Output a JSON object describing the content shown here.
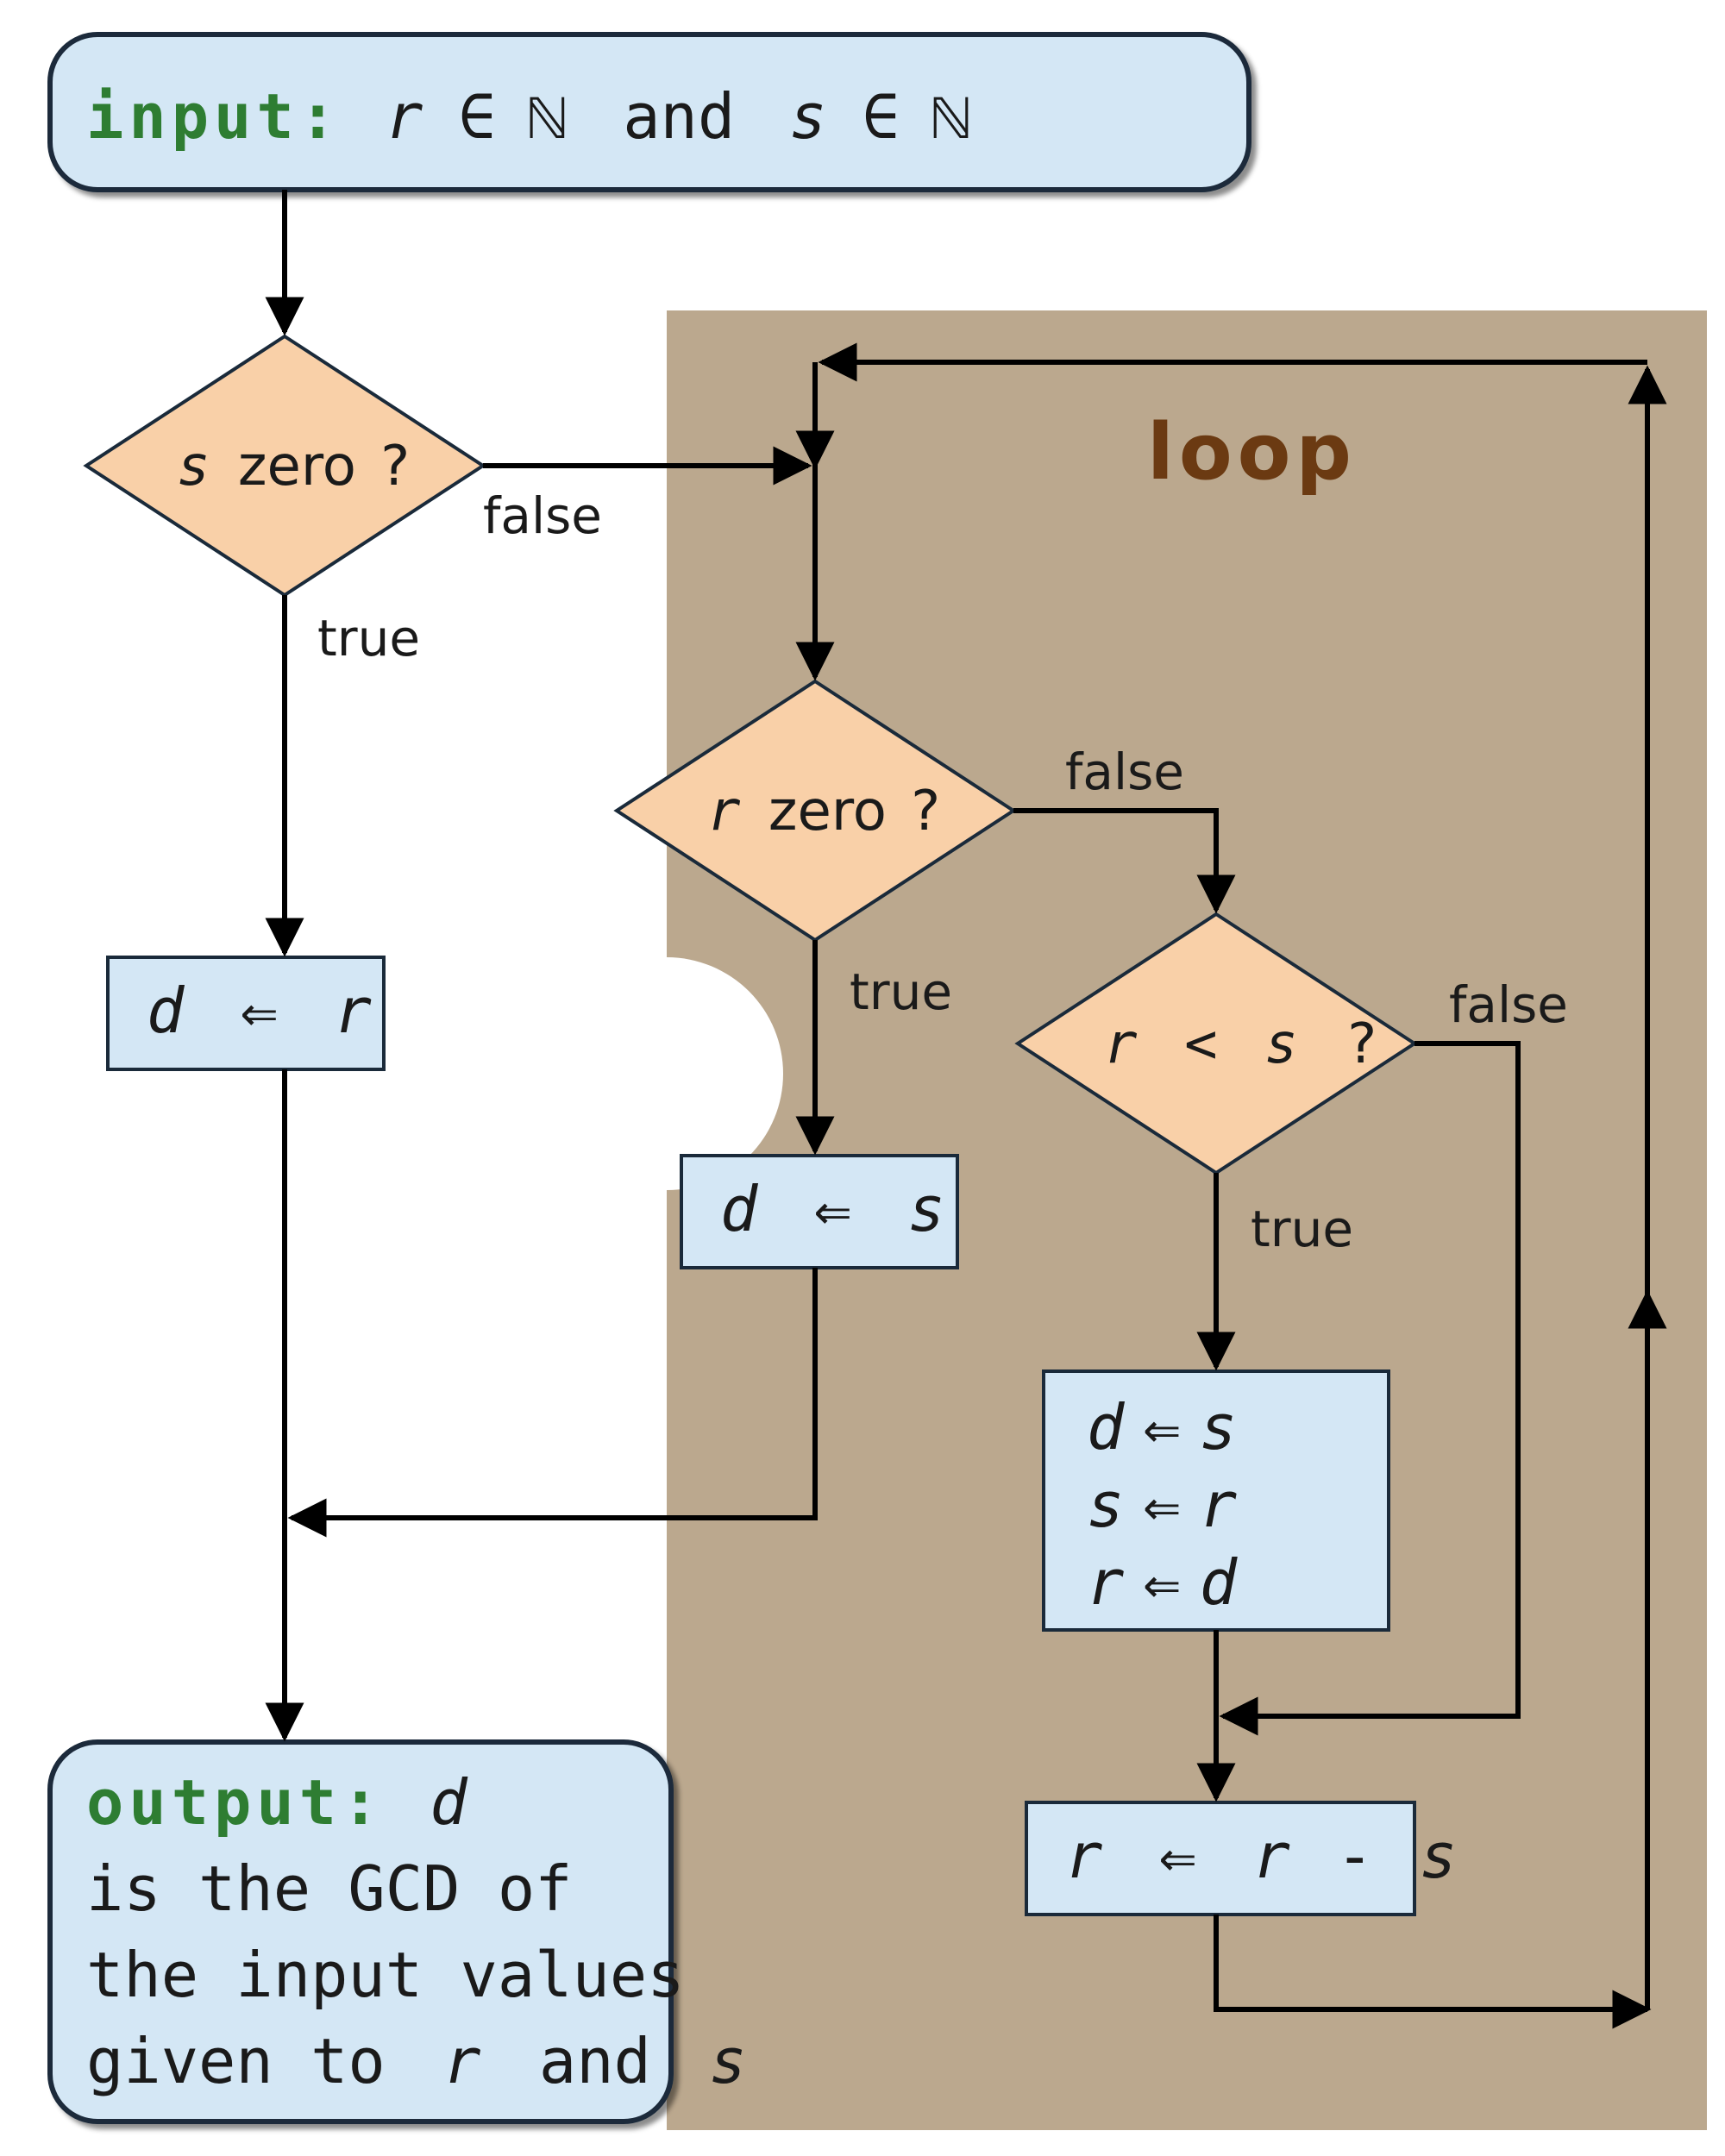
{
  "input": {
    "keyword": "input:",
    "expr_r": "r",
    "in1": "∈",
    "nat1": "ℕ",
    "and": "and",
    "expr_s": "s",
    "in2": "∈",
    "nat2": "ℕ"
  },
  "loop_label": "loop",
  "decisions": {
    "s_zero": {
      "var": "s",
      "txt": "zero",
      "q": "?",
      "true": "true",
      "false": "false"
    },
    "r_zero": {
      "var": "r",
      "txt": "zero",
      "q": "?",
      "true": "true",
      "false": "false"
    },
    "r_lt_s": {
      "lhs": "r",
      "op": "<",
      "rhs": "s",
      "q": "?",
      "true": "true",
      "false": "false"
    }
  },
  "processes": {
    "d_gets_r": {
      "l": "d",
      "op": "⇐",
      "r": "r"
    },
    "d_gets_s": {
      "l": "d",
      "op": "⇐",
      "r": "s"
    },
    "swap1": {
      "l": "d",
      "op": "⇐",
      "r": "s"
    },
    "swap2": {
      "l": "s",
      "op": "⇐",
      "r": "r"
    },
    "swap3": {
      "l": "r",
      "op": "⇐",
      "r": "d"
    },
    "sub": {
      "l": "r",
      "op": "⇐",
      "a": "r",
      "minus": "-",
      "b": "s"
    }
  },
  "output": {
    "keyword": "output:",
    "var": "d",
    "line2a": "is  the  GCD  of",
    "line3a": "the  input  values",
    "line4a": "given  to",
    "r": "r",
    "and": "and",
    "s": "s"
  }
}
